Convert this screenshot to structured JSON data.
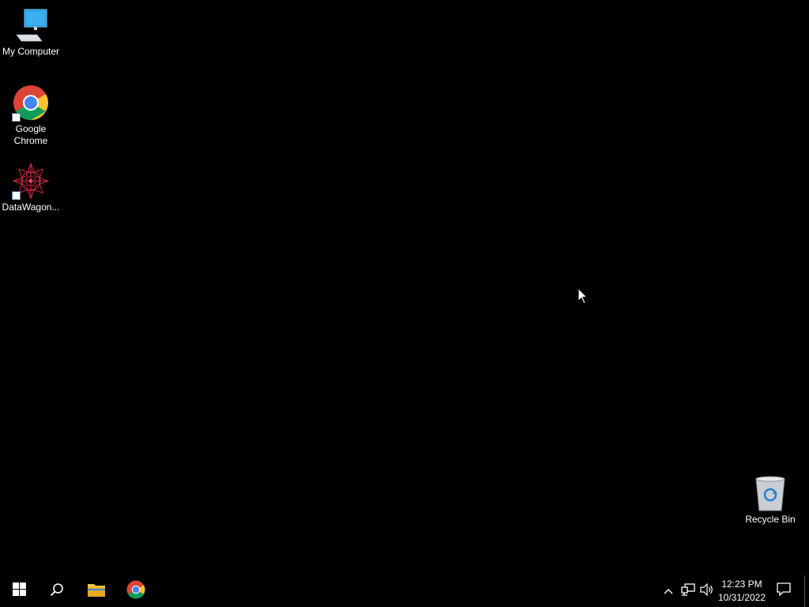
{
  "desktop": {
    "icons": [
      {
        "label": "My Computer",
        "icon": "computer-icon",
        "shortcut": false
      },
      {
        "label": "Google Chrome",
        "icon": "chrome-icon",
        "shortcut": true
      },
      {
        "label": "DataWagon...",
        "icon": "datawagon-icon",
        "shortcut": true
      },
      {
        "label": "Recycle Bin",
        "icon": "recycle-bin-icon",
        "shortcut": false
      }
    ],
    "background_color": "#000000"
  },
  "taskbar": {
    "pinned": [
      {
        "name": "Start",
        "icon": "windows-start-icon"
      },
      {
        "name": "Search",
        "icon": "search-icon"
      },
      {
        "name": "File Explorer",
        "icon": "folder-icon"
      },
      {
        "name": "Google Chrome",
        "icon": "chrome-icon"
      }
    ],
    "tray": {
      "icons": [
        "chevron-up-icon",
        "network-icon",
        "volume-icon",
        "notification-icon"
      ],
      "time": "12:23 PM",
      "date": "10/31/2022"
    }
  }
}
